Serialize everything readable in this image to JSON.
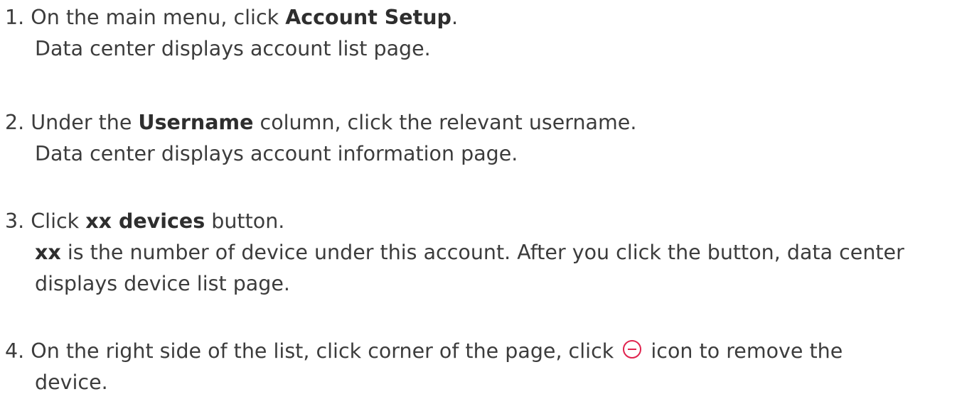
{
  "steps": [
    {
      "number": "1.",
      "pre": "On the main menu, click ",
      "bold": "Account Setup",
      "post": ".",
      "result": "Data center displays account list page."
    },
    {
      "number": "2.",
      "pre": "Under the ",
      "bold": "Username",
      "post": " column, click the relevant username.",
      "result": "Data center displays account information page."
    },
    {
      "number": "3.",
      "pre": "Click ",
      "bold": "xx devices",
      "post": " button.",
      "result_bold": "xx",
      "result": " is the number of device under this account. After you click the button, data center displays device list page."
    },
    {
      "number": "4.",
      "pre": "On the right side of the list, click corner of the page, click ",
      "icon": "minus-circle-icon",
      "icon_color": "#e0234e",
      "post": " icon to remove the",
      "continuation": "device."
    }
  ]
}
